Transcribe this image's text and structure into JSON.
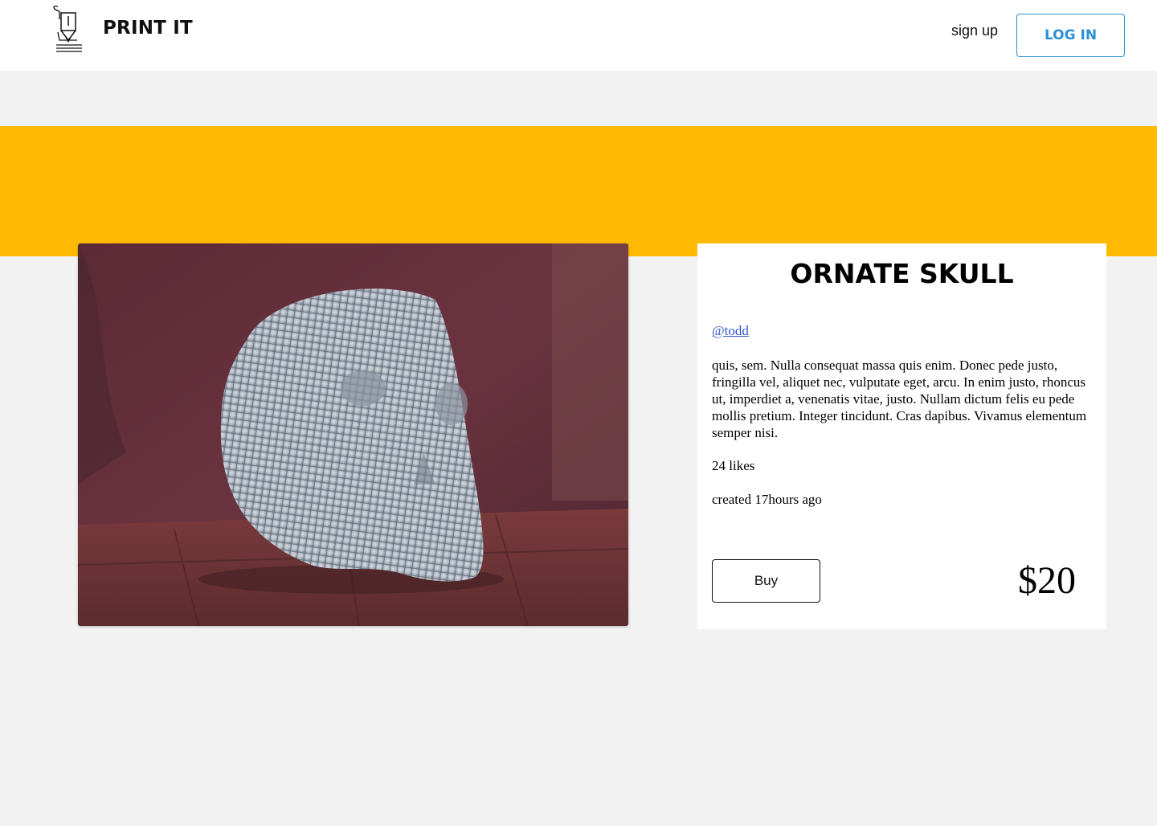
{
  "header": {
    "brand": "PRINT IT",
    "logo_icon": "3d-printer-nozzle-icon",
    "signup_label": "sign up",
    "login_label": "LOG IN"
  },
  "colors": {
    "banner": "#ffba00",
    "accent": "#2d8fd5",
    "link": "#3355cc",
    "background": "#f2f2f2"
  },
  "product": {
    "title": "ORNATE SKULL",
    "author": "@todd",
    "description": "quis, sem. Nulla consequat massa quis enim. Donec pede justo, fringilla vel, aliquet nec, vulputate eget, arcu. In enim justo, rhoncus ut, imperdiet a, venenatis vitae, justo. Nullam dictum felis eu pede mollis pretium. Integer tincidunt. Cras dapibus. Vivamus elementum semper nisi.",
    "likes": "24 likes",
    "created": "created 17hours ago",
    "buy_label": "Buy",
    "price": "$20"
  }
}
